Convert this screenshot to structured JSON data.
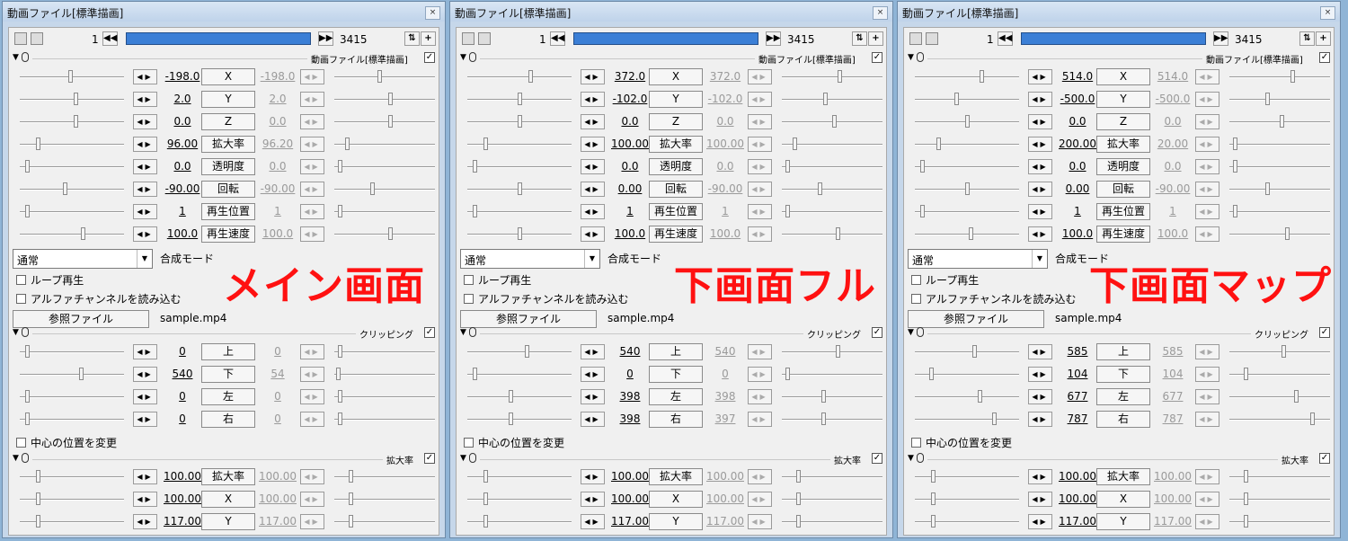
{
  "ui": {
    "window_title": "動画ファイル[標準描画]",
    "close_glyph": "×",
    "frame_start": "1",
    "frame_end": "3415",
    "section_video": "動画ファイル[標準描画]",
    "section_clip": "クリッピング",
    "section_scale": "拡大率",
    "blend_label": "合成モード",
    "blend_value": "通常",
    "loop_label": "ループ再生",
    "alpha_label": "アルファチャンネルを読み込む",
    "ref_button": "参照ファイル",
    "ref_file": "sample.mp4",
    "center_label": "中心の位置を変更",
    "video_params": [
      "X",
      "Y",
      "Z",
      "拡大率",
      "透明度",
      "回転",
      "再生位置",
      "再生速度"
    ],
    "clip_params": [
      "上",
      "下",
      "左",
      "右"
    ],
    "scale_params": [
      "拡大率",
      "X",
      "Y"
    ]
  },
  "windows": [
    {
      "overlay": "メイン画面",
      "video": [
        {
          "v": "-198.0",
          "e": "-198.0"
        },
        {
          "v": "2.0",
          "e": "2.0"
        },
        {
          "v": "0.0",
          "e": "0.0"
        },
        {
          "v": "96.00",
          "e": "96.20"
        },
        {
          "v": "0.0",
          "e": "0.0"
        },
        {
          "v": "-90.00",
          "e": "-90.00"
        },
        {
          "v": "1",
          "e": "1"
        },
        {
          "v": "100.0",
          "e": "100.0"
        }
      ],
      "clip": [
        {
          "v": "0",
          "e": "0"
        },
        {
          "v": "540",
          "e": "54"
        },
        {
          "v": "0",
          "e": "0"
        },
        {
          "v": "0",
          "e": "0"
        }
      ],
      "scale": [
        {
          "v": "100.00",
          "e": "100.00"
        },
        {
          "v": "100.00",
          "e": "100.00"
        },
        {
          "v": "117.00",
          "e": "117.00"
        }
      ]
    },
    {
      "overlay": "下画面フル",
      "video": [
        {
          "v": "372.0",
          "e": "372.0"
        },
        {
          "v": "-102.0",
          "e": "-102.0"
        },
        {
          "v": "0.0",
          "e": "0.0"
        },
        {
          "v": "100.00",
          "e": "100.00"
        },
        {
          "v": "0.0",
          "e": "0.0"
        },
        {
          "v": "0.00",
          "e": "-90.00"
        },
        {
          "v": "1",
          "e": "1"
        },
        {
          "v": "100.0",
          "e": "100.0"
        }
      ],
      "clip": [
        {
          "v": "540",
          "e": "540"
        },
        {
          "v": "0",
          "e": "0"
        },
        {
          "v": "398",
          "e": "398"
        },
        {
          "v": "398",
          "e": "397"
        }
      ],
      "scale": [
        {
          "v": "100.00",
          "e": "100.00"
        },
        {
          "v": "100.00",
          "e": "100.00"
        },
        {
          "v": "117.00",
          "e": "117.00"
        }
      ]
    },
    {
      "overlay": "下画面マップ",
      "video": [
        {
          "v": "514.0",
          "e": "514.0"
        },
        {
          "v": "-500.0",
          "e": "-500.0"
        },
        {
          "v": "0.0",
          "e": "0.0"
        },
        {
          "v": "200.00",
          "e": "20.00"
        },
        {
          "v": "0.0",
          "e": "0.0"
        },
        {
          "v": "0.00",
          "e": "-90.00"
        },
        {
          "v": "1",
          "e": "1"
        },
        {
          "v": "100.0",
          "e": "100.0"
        }
      ],
      "clip": [
        {
          "v": "585",
          "e": "585"
        },
        {
          "v": "104",
          "e": "104"
        },
        {
          "v": "677",
          "e": "677"
        },
        {
          "v": "787",
          "e": "787"
        }
      ],
      "scale": [
        {
          "v": "100.00",
          "e": "100.00"
        },
        {
          "v": "100.00",
          "e": "100.00"
        },
        {
          "v": "117.00",
          "e": "117.00"
        }
      ]
    }
  ]
}
